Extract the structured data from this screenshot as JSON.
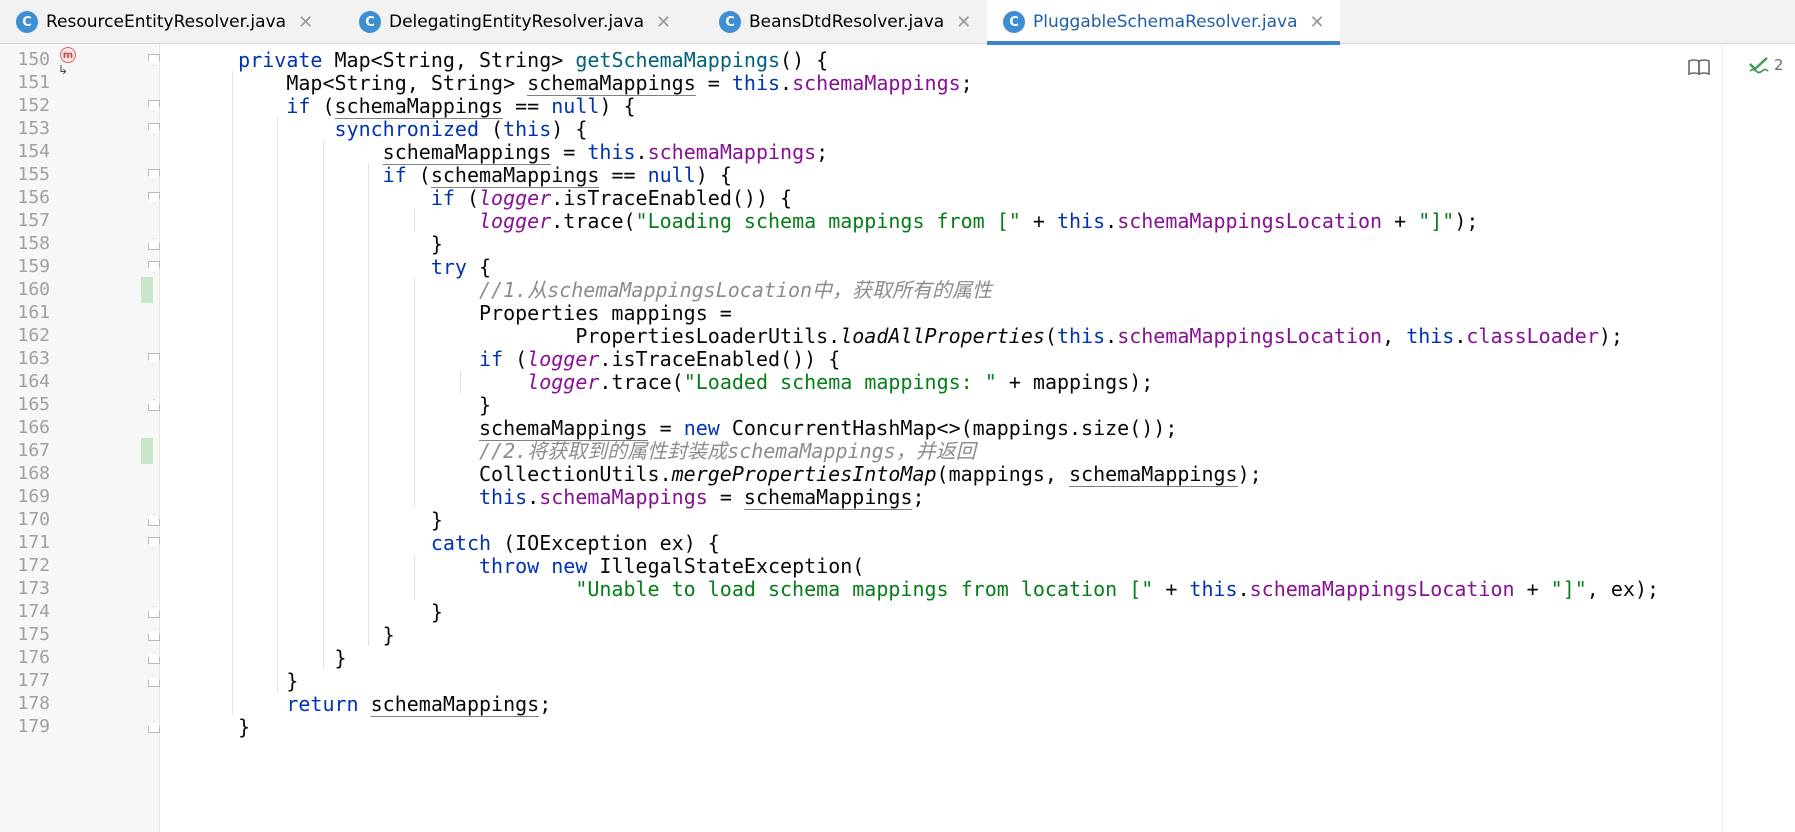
{
  "tabs": [
    {
      "label": "ResourceEntityResolver.java",
      "icon": "class-icon",
      "icon_letter": "C",
      "active": false
    },
    {
      "label": "DelegatingEntityResolver.java",
      "icon": "class-icon",
      "icon_letter": "C",
      "active": false
    },
    {
      "label": "BeansDtdResolver.java",
      "icon": "class-icon",
      "icon_letter": "C",
      "active": false
    },
    {
      "label": "PluggableSchemaResolver.java",
      "icon": "class-icon",
      "icon_letter": "C",
      "active": true
    }
  ],
  "close_glyph": "✕",
  "gutter": {
    "method_marker": "m",
    "line_numbers": [
      "150",
      "151",
      "152",
      "153",
      "154",
      "155",
      "156",
      "157",
      "158",
      "159",
      "160",
      "161",
      "162",
      "163",
      "164",
      "165",
      "166",
      "167",
      "168",
      "169",
      "170",
      "171",
      "172",
      "173",
      "174",
      "175",
      "176",
      "177",
      "178",
      "179"
    ]
  },
  "inspections": {
    "count": "2",
    "icon": "check-icon"
  },
  "reader_mode_icon": "book-icon",
  "colors": {
    "keyword": "#0033b3",
    "method": "#00627a",
    "field": "#871094",
    "string": "#067d17",
    "comment": "#8c8c8c",
    "tab_accent": "#4083c9",
    "class_icon": "#3d8fd1"
  },
  "code": [
    [
      {
        "t": "    "
      },
      {
        "t": "private",
        "c": "kw"
      },
      {
        "t": " Map<String, String> "
      },
      {
        "t": "getSchemaMappings",
        "c": "fn"
      },
      {
        "t": "() {"
      }
    ],
    [
      {
        "t": "        Map<String, String> "
      },
      {
        "t": "schemaMappings",
        "c": "ul"
      },
      {
        "t": " = "
      },
      {
        "t": "this",
        "c": "kw"
      },
      {
        "t": "."
      },
      {
        "t": "schemaMappings",
        "c": "fld"
      },
      {
        "t": ";"
      }
    ],
    [
      {
        "t": "        "
      },
      {
        "t": "if",
        "c": "kw"
      },
      {
        "t": " ("
      },
      {
        "t": "schemaMappings",
        "c": "ul"
      },
      {
        "t": " == "
      },
      {
        "t": "null",
        "c": "kw"
      },
      {
        "t": ") {"
      }
    ],
    [
      {
        "t": "            "
      },
      {
        "t": "synchronized",
        "c": "kw"
      },
      {
        "t": " ("
      },
      {
        "t": "this",
        "c": "kw"
      },
      {
        "t": ") {"
      }
    ],
    [
      {
        "t": "                "
      },
      {
        "t": "schemaMappings",
        "c": "ul"
      },
      {
        "t": " = "
      },
      {
        "t": "this",
        "c": "kw"
      },
      {
        "t": "."
      },
      {
        "t": "schemaMappings",
        "c": "fld"
      },
      {
        "t": ";"
      }
    ],
    [
      {
        "t": "                "
      },
      {
        "t": "if",
        "c": "kw"
      },
      {
        "t": " ("
      },
      {
        "t": "schemaMappings",
        "c": "ul"
      },
      {
        "t": " == "
      },
      {
        "t": "null",
        "c": "kw"
      },
      {
        "t": ") {"
      }
    ],
    [
      {
        "t": "                    "
      },
      {
        "t": "if",
        "c": "kw"
      },
      {
        "t": " ("
      },
      {
        "t": "logger",
        "c": "logger"
      },
      {
        "t": ".isTraceEnabled()) {"
      }
    ],
    [
      {
        "t": "                        "
      },
      {
        "t": "logger",
        "c": "logger"
      },
      {
        "t": ".trace("
      },
      {
        "t": "\"Loading schema mappings from [\"",
        "c": "str"
      },
      {
        "t": " + "
      },
      {
        "t": "this",
        "c": "kw"
      },
      {
        "t": "."
      },
      {
        "t": "schemaMappingsLocation",
        "c": "fld"
      },
      {
        "t": " + "
      },
      {
        "t": "\"]\"",
        "c": "str"
      },
      {
        "t": ");"
      }
    ],
    [
      {
        "t": "                    }"
      }
    ],
    [
      {
        "t": "                    "
      },
      {
        "t": "try",
        "c": "kw"
      },
      {
        "t": " {"
      }
    ],
    [
      {
        "t": "                        "
      },
      {
        "t": "//1.从schemaMappingsLocation中，获取所有的属性",
        "c": "cm"
      }
    ],
    [
      {
        "t": "                        Properties mappings ="
      }
    ],
    [
      {
        "t": "                                PropertiesLoaderUtils."
      },
      {
        "t": "loadAllProperties",
        "c": "it"
      },
      {
        "t": "("
      },
      {
        "t": "this",
        "c": "kw"
      },
      {
        "t": "."
      },
      {
        "t": "schemaMappingsLocation",
        "c": "fld"
      },
      {
        "t": ", "
      },
      {
        "t": "this",
        "c": "kw"
      },
      {
        "t": "."
      },
      {
        "t": "classLoader",
        "c": "fld"
      },
      {
        "t": ");"
      }
    ],
    [
      {
        "t": "                        "
      },
      {
        "t": "if",
        "c": "kw"
      },
      {
        "t": " ("
      },
      {
        "t": "logger",
        "c": "logger"
      },
      {
        "t": ".isTraceEnabled()) {"
      }
    ],
    [
      {
        "t": "                            "
      },
      {
        "t": "logger",
        "c": "logger"
      },
      {
        "t": ".trace("
      },
      {
        "t": "\"Loaded schema mappings: \"",
        "c": "str"
      },
      {
        "t": " + mappings);"
      }
    ],
    [
      {
        "t": "                        }"
      }
    ],
    [
      {
        "t": "                        "
      },
      {
        "t": "schemaMappings",
        "c": "ul"
      },
      {
        "t": " = "
      },
      {
        "t": "new",
        "c": "kw"
      },
      {
        "t": " ConcurrentHashMap<>(mappings.size());"
      }
    ],
    [
      {
        "t": "                        "
      },
      {
        "t": "//2.将获取到的属性封装成schemaMappings，并返回",
        "c": "cm"
      }
    ],
    [
      {
        "t": "                        CollectionUtils."
      },
      {
        "t": "mergePropertiesIntoMap",
        "c": "it"
      },
      {
        "t": "(mappings, "
      },
      {
        "t": "schemaMappings",
        "c": "ul"
      },
      {
        "t": ");"
      }
    ],
    [
      {
        "t": "                        "
      },
      {
        "t": "this",
        "c": "kw"
      },
      {
        "t": "."
      },
      {
        "t": "schemaMappings",
        "c": "fld"
      },
      {
        "t": " = "
      },
      {
        "t": "schemaMappings",
        "c": "ul"
      },
      {
        "t": ";"
      }
    ],
    [
      {
        "t": "                    }"
      }
    ],
    [
      {
        "t": "                    "
      },
      {
        "t": "catch",
        "c": "kw"
      },
      {
        "t": " (IOException ex) {"
      }
    ],
    [
      {
        "t": "                        "
      },
      {
        "t": "throw",
        "c": "kw"
      },
      {
        "t": " "
      },
      {
        "t": "new",
        "c": "kw"
      },
      {
        "t": " IllegalStateException("
      }
    ],
    [
      {
        "t": "                                "
      },
      {
        "t": "\"Unable to load schema mappings from location [\"",
        "c": "str"
      },
      {
        "t": " + "
      },
      {
        "t": "this",
        "c": "kw"
      },
      {
        "t": "."
      },
      {
        "t": "schemaMappingsLocation",
        "c": "fld"
      },
      {
        "t": " + "
      },
      {
        "t": "\"]\"",
        "c": "str"
      },
      {
        "t": ", ex);"
      }
    ],
    [
      {
        "t": "                    }"
      }
    ],
    [
      {
        "t": "                }"
      }
    ],
    [
      {
        "t": "            }"
      }
    ],
    [
      {
        "t": "        }"
      }
    ],
    [
      {
        "t": "        "
      },
      {
        "t": "return",
        "c": "kw"
      },
      {
        "t": " "
      },
      {
        "t": "schemaMappings",
        "c": "ul"
      },
      {
        "t": ";"
      }
    ],
    [
      {
        "t": "    }"
      }
    ]
  ]
}
